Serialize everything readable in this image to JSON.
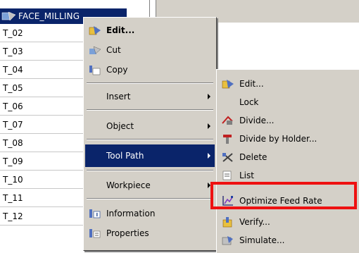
{
  "tree": {
    "header_label": "FACE_MILLING",
    "rows": [
      "T_02",
      "T_03",
      "T_04",
      "T_05",
      "T_06",
      "T_07",
      "T_08",
      "T_09",
      "T_10",
      "T_11",
      "T_12"
    ]
  },
  "menu1": {
    "items": [
      {
        "label": "Edit..."
      },
      {
        "label": "Cut"
      },
      {
        "label": "Copy"
      },
      {
        "label": "Insert"
      },
      {
        "label": "Object"
      },
      {
        "label": "Tool Path"
      },
      {
        "label": "Workpiece"
      },
      {
        "label": "Information"
      },
      {
        "label": "Properties"
      }
    ]
  },
  "menu2": {
    "items": [
      {
        "label": "Edit..."
      },
      {
        "label": "Lock"
      },
      {
        "label": "Divide..."
      },
      {
        "label": "Divide by Holder..."
      },
      {
        "label": "Delete"
      },
      {
        "label": "List"
      },
      {
        "label": "Optimize Feed Rate"
      },
      {
        "label": "Verify..."
      },
      {
        "label": "Simulate..."
      }
    ]
  },
  "colors": {
    "selection": "#0a246a",
    "menu_bg": "#d4d0c8",
    "highlight": "#ee1111"
  }
}
